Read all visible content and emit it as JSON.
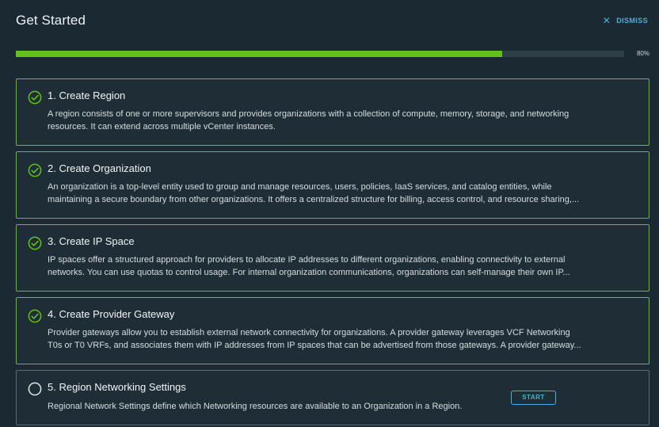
{
  "header": {
    "title": "Get Started",
    "dismiss_label": "DISMISS",
    "dismiss_icon": "close-icon"
  },
  "progress": {
    "percent": 80,
    "label": "80%",
    "color": "#62c21b"
  },
  "steps": [
    {
      "title": "1. Create Region",
      "status": "complete",
      "desc_lines": [
        "A region consists of one or more supervisors and provides organizations with a collection of compute, memory, storage, and networking",
        "resources. It can extend across multiple vCenter instances."
      ]
    },
    {
      "title": "2. Create Organization",
      "status": "complete",
      "desc_lines": [
        "An organization is a top-level entity used to group and manage resources, users, policies, IaaS services, and catalog entities, while",
        "maintaining a secure boundary from other organizations. It offers a centralized structure for billing, access control, and resource sharing,..."
      ]
    },
    {
      "title": "3. Create IP Space",
      "status": "complete",
      "desc_lines": [
        "IP spaces offer a structured approach for providers to allocate IP addresses to different organizations, enabling connectivity to external",
        "networks. You can use quotas to control usage. For internal organization communications, organizations can self-manage their own IP..."
      ]
    },
    {
      "title": "4. Create Provider Gateway",
      "status": "complete",
      "desc_lines": [
        "Provider gateways allow you to establish external network connectivity for organizations. A provider gateway leverages VCF Networking",
        "T0s or T0 VRFs, and associates them with IP addresses from IP spaces that can be advertised from those gateways. A provider gateway..."
      ]
    },
    {
      "title": "5. Region Networking Settings",
      "status": "pending",
      "desc_lines": [
        "Regional Network Settings define which Networking resources are available to an Organization in a Region."
      ],
      "action_label": "START"
    }
  ],
  "colors": {
    "accent_green": "#62c21b",
    "link_blue": "#49afd9",
    "background": "#1b2a32"
  }
}
